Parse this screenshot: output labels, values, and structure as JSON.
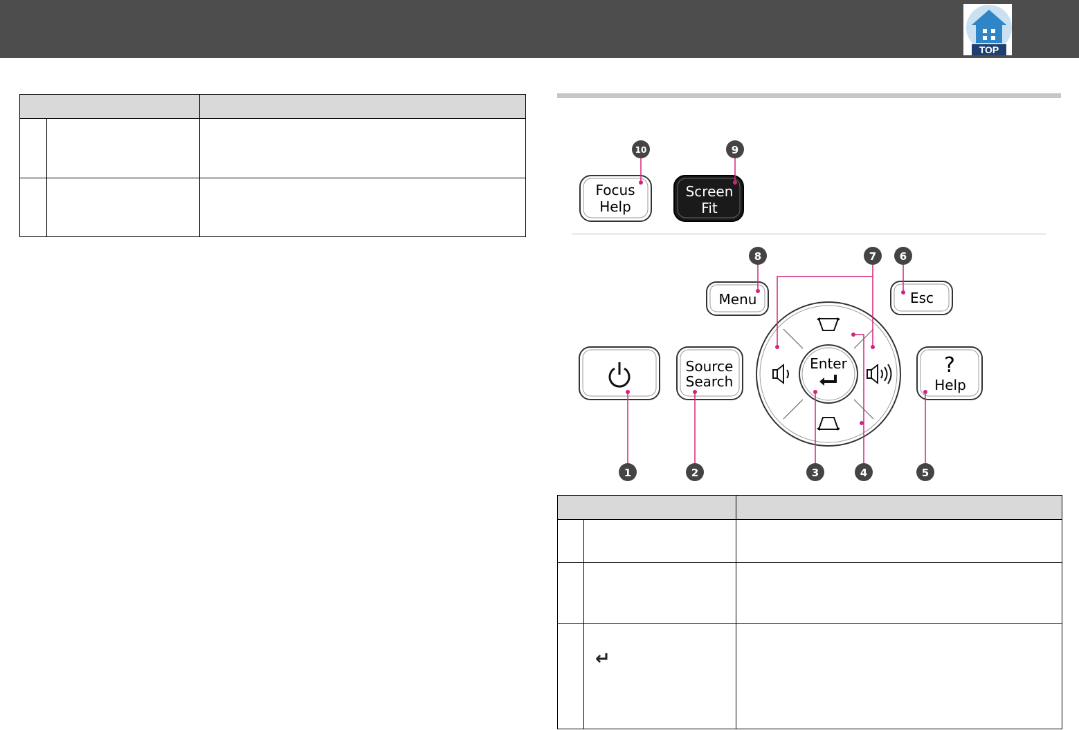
{
  "header": {
    "top_label": "TOP"
  },
  "colors": {
    "header_bg": "#4d4d4d",
    "table_header_bg": "#d9d9d9",
    "callout": "#d4247a",
    "top_icon": "#2f86c6"
  },
  "diagram": {
    "buttons": {
      "focus_help": [
        "Focus",
        "Help"
      ],
      "screen_fit": [
        "Screen",
        "Fit"
      ],
      "menu": "Menu",
      "esc": "Esc",
      "source_search": [
        "Source",
        "Search"
      ],
      "enter": "Enter",
      "help": "Help"
    },
    "callout_numbers": [
      "1",
      "2",
      "3",
      "4",
      "5",
      "6",
      "7",
      "8",
      "9",
      "10"
    ]
  },
  "table2": {
    "enter_symbol": "↵"
  }
}
